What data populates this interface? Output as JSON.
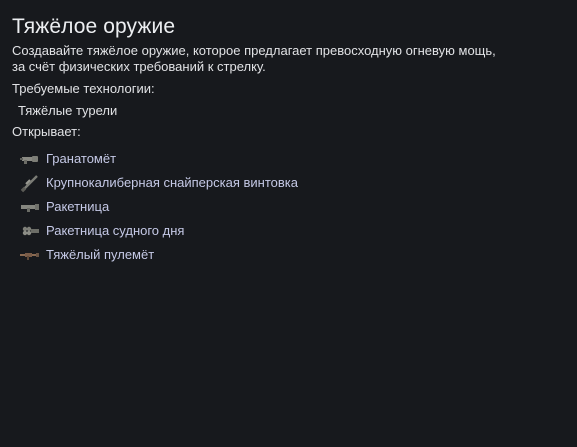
{
  "header": {
    "title": "Тяжёлое оружие"
  },
  "description": {
    "line1": "Создавайте тяжёлое оружие, которое предлагает превосходную огневую мощь,",
    "line2": "за счёт физических требований к стрелку."
  },
  "requirements": {
    "label": "Требуемые технологии:",
    "items": [
      {
        "label": "Тяжёлые турели"
      }
    ]
  },
  "unlocks": {
    "label": "Открывает:",
    "items": [
      {
        "label": "Гранатомёт",
        "icon": "grenade-launcher-icon"
      },
      {
        "label": "Крупнокалиберная снайперская винтовка",
        "icon": "sniper-rifle-icon"
      },
      {
        "label": "Ракетница",
        "icon": "rocket-launcher-icon"
      },
      {
        "label": "Ракетница судного дня",
        "icon": "doomsday-rocket-launcher-icon"
      },
      {
        "label": "Тяжёлый пулемёт",
        "icon": "heavy-machine-gun-icon"
      }
    ]
  },
  "colors": {
    "background": "#17191d",
    "text": "#e1e2e5",
    "link": "#c5c9e6"
  }
}
